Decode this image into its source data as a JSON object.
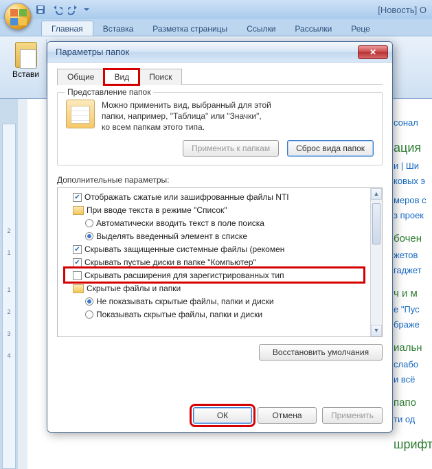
{
  "office": {
    "doc_title": "[Новость] О",
    "qat": {
      "save_icon": "save-icon",
      "undo_icon": "undo-icon",
      "redo_icon": "redo-icon"
    }
  },
  "ribbon": {
    "tabs": [
      "Главная",
      "Вставка",
      "Разметка страницы",
      "Ссылки",
      "Рассылки",
      "Реце"
    ],
    "paste_label": "Встави"
  },
  "side": {
    "items": [
      "сонал",
      "ация",
      "и  |  Ши",
      "ковых э",
      "меров с",
      "з проек",
      "бочен",
      "жетов",
      "гаджет",
      "ч и м",
      "е \"Пус",
      "браже",
      "иальн",
      "слабо",
      "и всё",
      "папо",
      "ти од"
    ],
    "green": "шрифты"
  },
  "dialog": {
    "title": "Параметры папок",
    "tabs": {
      "general": "Общие",
      "view": "Вид",
      "search": "Поиск"
    },
    "group_repr": {
      "legend": "Представление папок",
      "text_l1": "Можно применить вид, выбранный для этой",
      "text_l2": "папки, например, \"Таблица\" или \"Значки\",",
      "text_l3": "ко всем папкам этого типа.",
      "btn_apply": "Применить к папкам",
      "btn_reset": "Сброс вида папок"
    },
    "adv_label": "Дополнительные параметры:",
    "tree": [
      {
        "kind": "check",
        "checked": true,
        "indent": 0,
        "label": "Отображать сжатые или зашифрованные файлы NTI"
      },
      {
        "kind": "folder",
        "indent": 0,
        "label": "При вводе текста в режиме \"Список\""
      },
      {
        "kind": "radio",
        "sel": false,
        "indent": 1,
        "label": "Автоматически вводить текст в поле поиска"
      },
      {
        "kind": "radio",
        "sel": true,
        "indent": 1,
        "label": "Выделять введенный элемент в списке"
      },
      {
        "kind": "check",
        "checked": true,
        "indent": 0,
        "label": "Скрывать защищенные системные файлы (рекомен"
      },
      {
        "kind": "check",
        "checked": true,
        "indent": 0,
        "label": "Скрывать пустые диски в папке \"Компьютер\""
      },
      {
        "kind": "check",
        "checked": false,
        "indent": 0,
        "label": "Скрывать расширения для зарегистрированных тип"
      },
      {
        "kind": "folder",
        "indent": 0,
        "label": "Скрытые файлы и папки"
      },
      {
        "kind": "radio",
        "sel": true,
        "indent": 1,
        "label": "Не показывать скрытые файлы, папки и диски"
      },
      {
        "kind": "radio",
        "sel": false,
        "indent": 1,
        "label": "Показывать скрытые файлы, папки и диски"
      }
    ],
    "btn_restore": "Восстановить умолчания",
    "footer": {
      "ok": "ОК",
      "cancel": "Отмена",
      "apply": "Применить"
    }
  },
  "ruler": [
    "2",
    "1",
    "",
    "1",
    "2",
    "3",
    "4"
  ]
}
